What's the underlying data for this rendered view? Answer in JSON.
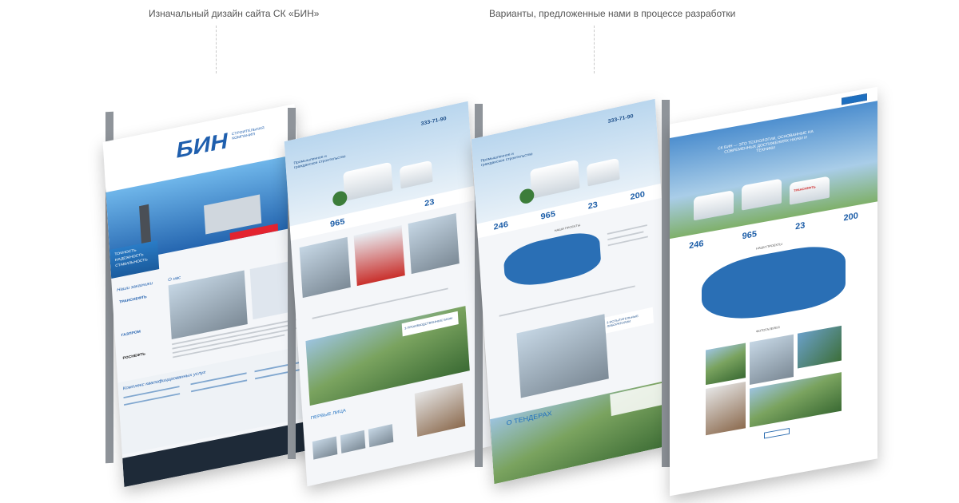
{
  "captions": {
    "left": "Изначальный дизайн сайта СК «БИН»",
    "right": "Варианты, предложенные нами в процессе разработки"
  },
  "original": {
    "logo": "БИН",
    "logo_sub": "СТРОИТЕЛЬНАЯ КОМПАНИЯ",
    "slogan": [
      "ТОЧНОСТЬ",
      "НАДЕЖНОСТЬ",
      "СТАБИЛЬНОСТЬ"
    ],
    "partners_title": "Наши заказчики",
    "partners": [
      "ТРАНСНЕФТЬ",
      "ГАЗПРОМ",
      "РОСНЕФТЬ"
    ],
    "about_title": "О нас",
    "services_title": "Комплекс квалифицированных услуг"
  },
  "variant1": {
    "phone": "333-71-90",
    "hero_title": "Промышленное и гражданское строительство",
    "stats": [
      {
        "num": "965",
        "label": ""
      },
      {
        "num": "23",
        "label": ""
      }
    ],
    "section": "3 ПРОИЗВОДСТВЕННЫЕ БАЗЫ",
    "news": "ПЕРВЫЕ ЛИЦА"
  },
  "variant2": {
    "phone": "333-71-90",
    "hero_title": "Промышленное и гражданское строительство",
    "stats": [
      {
        "num": "246",
        "label": ""
      },
      {
        "num": "965",
        "label": ""
      },
      {
        "num": "23",
        "label": ""
      },
      {
        "num": "200",
        "label": ""
      }
    ],
    "projects": "НАШИ ПРОЕКТЫ",
    "labs": "3 ИСПЫТАТЕЛЬНЫЕ ЛАБОРАТОРИИ",
    "tenders": "О ТЕНДЕРАХ"
  },
  "variant3": {
    "hero_title": "СК БИН — ЭТО ТЕХНОЛОГИИ, ОСНОВАННЫЕ НА СОВРЕМЕННЫХ ДОСТИЖЕНИЯХ НАУКИ И ТЕХНИКИ",
    "stats": [
      {
        "num": "246",
        "label": ""
      },
      {
        "num": "965",
        "label": ""
      },
      {
        "num": "23",
        "label": ""
      },
      {
        "num": "200",
        "label": ""
      }
    ],
    "projects": "НАШИ ПРОЕКТЫ",
    "gallery": "ФОТОГАЛЕРЕЯ",
    "tank_label": "ТРАНСНЕФТЬ"
  }
}
